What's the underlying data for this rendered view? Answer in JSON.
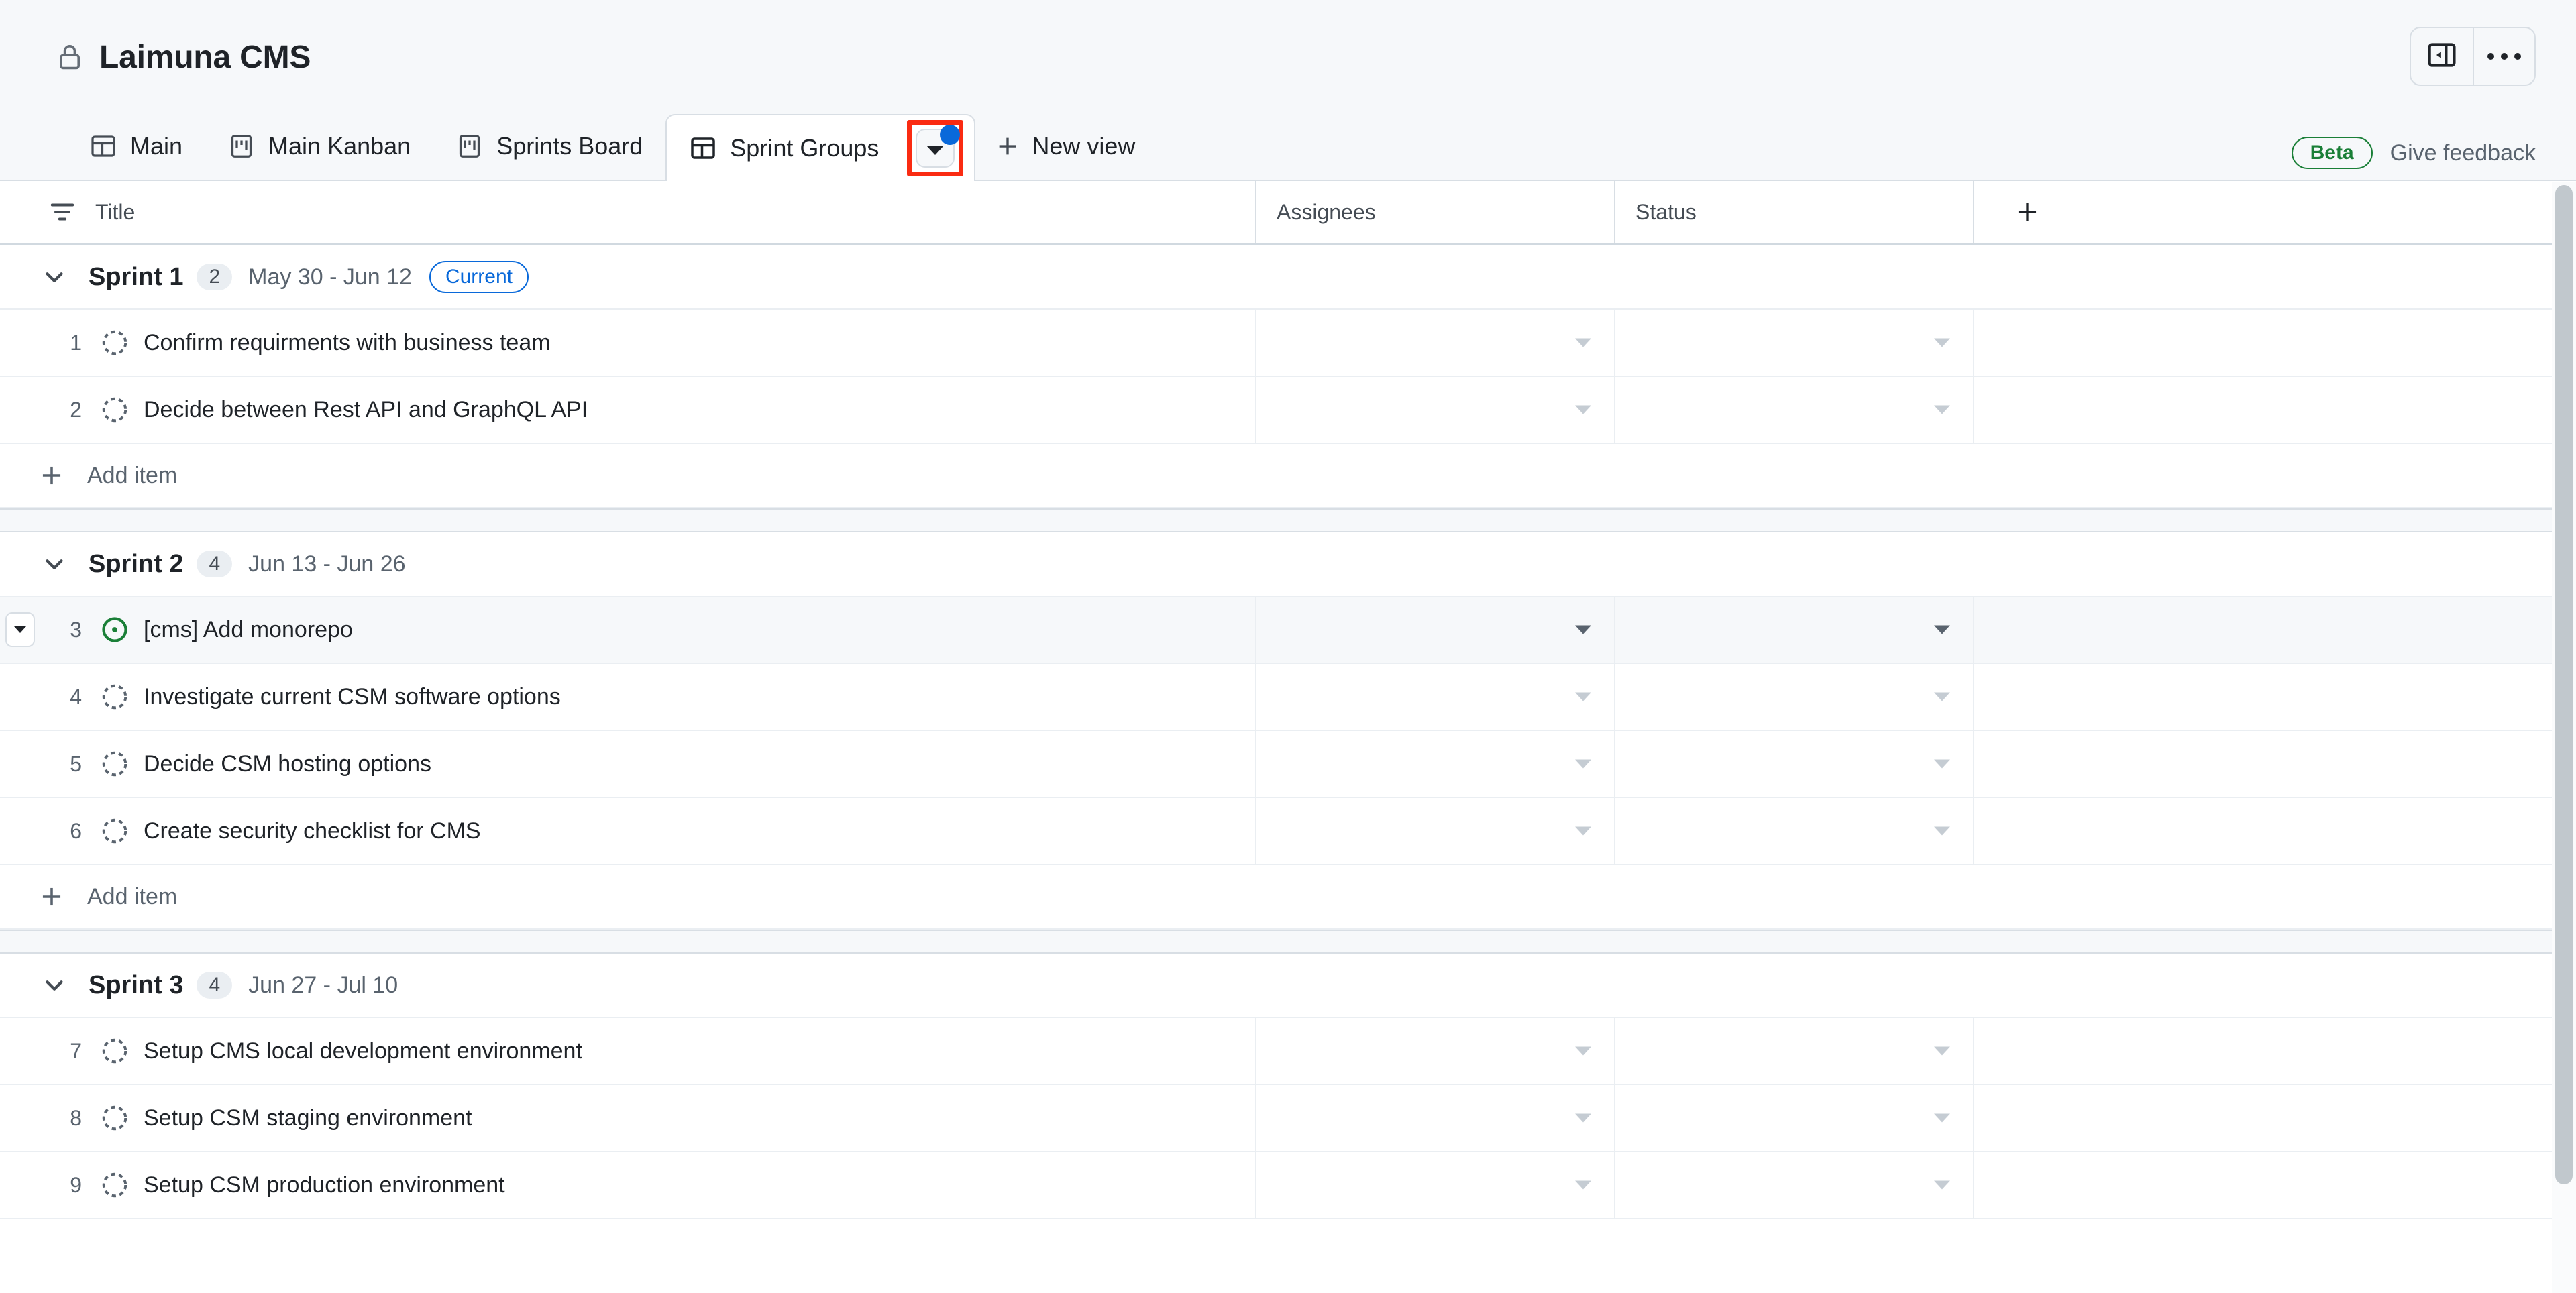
{
  "window": {
    "title": "Laimuna CMS",
    "lock_icon": "lock-icon",
    "sidebar_toggle_icon": "sidebar-collapse-icon",
    "more_icon": "kebab-more-icon"
  },
  "tabs": {
    "items": [
      {
        "label": "Main",
        "icon": "table-view-icon",
        "active": false
      },
      {
        "label": "Main Kanban",
        "icon": "board-view-icon",
        "active": false
      },
      {
        "label": "Sprints Board",
        "icon": "board-view-icon",
        "active": false
      },
      {
        "label": "Sprint Groups",
        "icon": "table-view-icon",
        "active": true
      }
    ],
    "view_options_icon": "triangle-down-icon",
    "view_options_has_changes": true,
    "new_view_label": "New view",
    "new_view_icon": "plus-icon",
    "beta_label": "Beta",
    "feedback_label": "Give feedback",
    "highlight_color": "#fa2b12",
    "accent_blue": "#0969da",
    "beta_green": "#1a7f37"
  },
  "table": {
    "filter_icon": "filter-icon",
    "add_column_icon": "plus-icon",
    "columns": [
      {
        "label": "Title"
      },
      {
        "label": "Assignees"
      },
      {
        "label": "Status"
      }
    ],
    "groups": [
      {
        "name": "Sprint 1",
        "count": "2",
        "dates": "May 30 - Jun 12",
        "badge": "Current",
        "collapse_icon": "chevron-down-icon",
        "add_item_label": "Add item",
        "rows": [
          {
            "num": "1",
            "icon": "draft-issue-icon",
            "title": "Confirm requirments with business team",
            "assignee": "",
            "status": "",
            "hover": false,
            "expandable": false
          },
          {
            "num": "2",
            "icon": "draft-issue-icon",
            "title": "Decide between Rest API and GraphQL API",
            "assignee": "",
            "status": "",
            "hover": false,
            "expandable": false
          }
        ]
      },
      {
        "name": "Sprint 2",
        "count": "4",
        "dates": "Jun 13 - Jun 26",
        "badge": "",
        "collapse_icon": "chevron-down-icon",
        "add_item_label": "Add item",
        "rows": [
          {
            "num": "3",
            "icon": "issue-open-icon",
            "title": "[cms] Add monorepo",
            "assignee": "",
            "status": "",
            "hover": true,
            "expandable": true
          },
          {
            "num": "4",
            "icon": "draft-issue-icon",
            "title": "Investigate current CSM software options",
            "assignee": "",
            "status": "",
            "hover": false,
            "expandable": false
          },
          {
            "num": "5",
            "icon": "draft-issue-icon",
            "title": "Decide CSM hosting options",
            "assignee": "",
            "status": "",
            "hover": false,
            "expandable": false
          },
          {
            "num": "6",
            "icon": "draft-issue-icon",
            "title": "Create security checklist for CMS",
            "assignee": "",
            "status": "",
            "hover": false,
            "expandable": false
          }
        ]
      },
      {
        "name": "Sprint 3",
        "count": "4",
        "dates": "Jun 27 - Jul 10",
        "badge": "",
        "collapse_icon": "chevron-down-icon",
        "add_item_label": "",
        "rows": [
          {
            "num": "7",
            "icon": "draft-issue-icon",
            "title": "Setup CMS local development environment",
            "assignee": "",
            "status": "",
            "hover": false,
            "expandable": false
          },
          {
            "num": "8",
            "icon": "draft-issue-icon",
            "title": "Setup CSM staging environment",
            "assignee": "",
            "status": "",
            "hover": false,
            "expandable": false
          },
          {
            "num": "9",
            "icon": "draft-issue-icon",
            "title": "Setup CSM production environment",
            "assignee": "",
            "status": "",
            "hover": false,
            "expandable": false
          }
        ]
      }
    ]
  },
  "scrollbar": {
    "name": "vertical-scrollbar"
  }
}
